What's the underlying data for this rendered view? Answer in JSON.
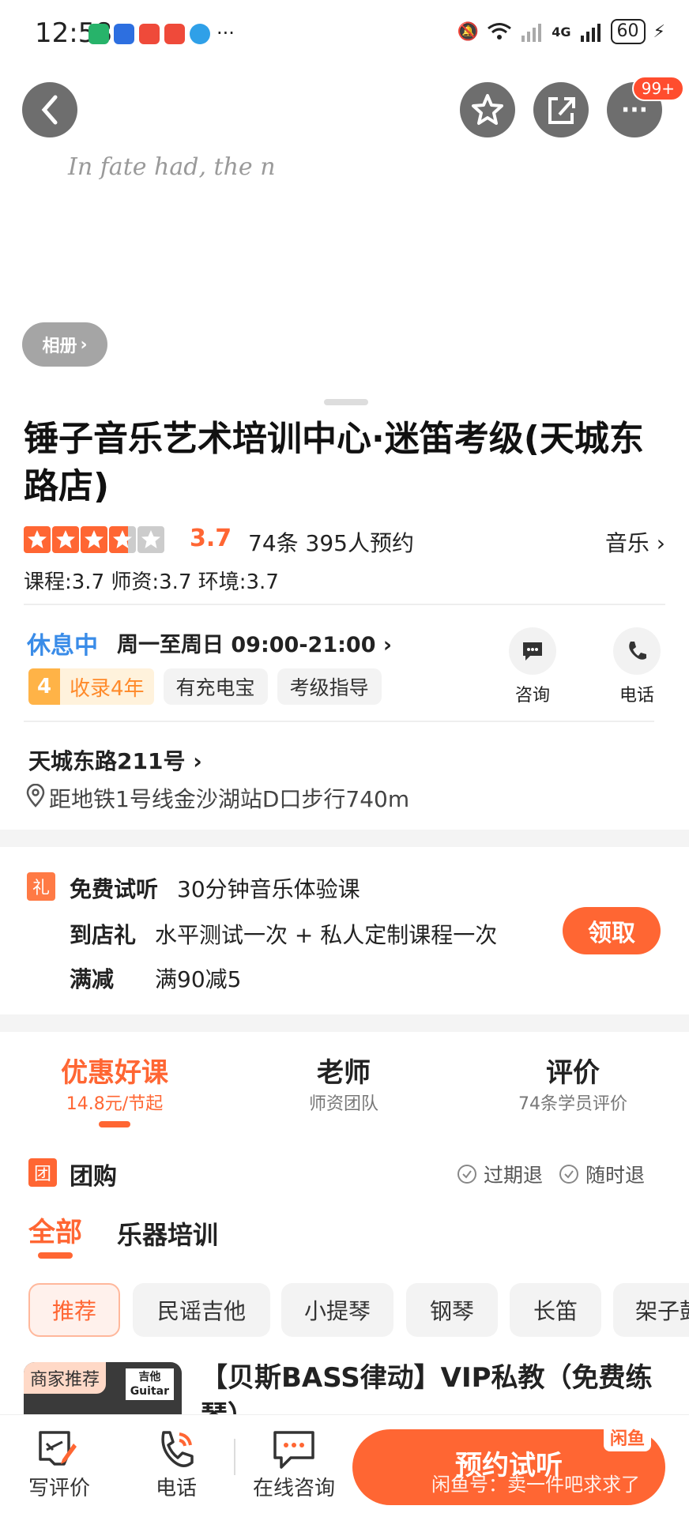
{
  "status": {
    "time": "12:58",
    "network": "4G",
    "battery": "60"
  },
  "topbar": {
    "badge": "99+"
  },
  "watermark": "In fate had, the n",
  "album_label": "相册",
  "shop": {
    "title": "锤子音乐艺术培训中心·迷笛考级(天城东路店)",
    "rating": "3.7",
    "rating_value": 3.7,
    "review_count": "74条",
    "bookings": "395人预约",
    "category": "音乐",
    "sub_scores": "课程:3.7  师资:3.7  环境:3.7"
  },
  "hours": {
    "status": "休息中",
    "text": "周一至周日 09:00-21:00"
  },
  "tags": {
    "years_num": "4",
    "years_text": "收录4年",
    "tag1": "有充电宝",
    "tag2": "考级指导"
  },
  "actions": {
    "consult": "咨询",
    "phone": "电话"
  },
  "address": {
    "street": "天城东路211号",
    "metro": "距地铁1号线金沙湖站D口步行740m"
  },
  "offers": {
    "gift_icon": "礼",
    "rows": [
      {
        "k": "免费试听",
        "v": "30分钟音乐体验课"
      },
      {
        "k": "到店礼",
        "v": "水平测试一次 + 私人定制课程一次"
      },
      {
        "k": "满减",
        "v": "满90减5"
      }
    ],
    "claim": "领取"
  },
  "tabs": [
    {
      "title": "优惠好课",
      "sub": "14.8元/节起"
    },
    {
      "title": "老师",
      "sub": "师资团队"
    },
    {
      "title": "评价",
      "sub": "74条学员评价"
    }
  ],
  "group": {
    "icon": "团",
    "title": "团购",
    "refund1": "过期退",
    "refund2": "随时退"
  },
  "subtabs": {
    "all": "全部",
    "training": "乐器培训"
  },
  "chips": [
    "推荐",
    "民谣吉他",
    "小提琴",
    "钢琴",
    "长笛",
    "架子鼓"
  ],
  "product": {
    "badge": "商家推荐",
    "thumb1": "吉他",
    "thumb2": "Guitar",
    "title": "【贝斯BASS律动】VIP私教（免费练琴）"
  },
  "bottom": {
    "review": "写评价",
    "phone": "电话",
    "online": "在线咨询",
    "book": "预约试听",
    "overlay": "闲鱼号：卖一件吧求求了",
    "logo": "闲鱼"
  },
  "colors": {
    "accent": "#ff6633",
    "blue": "#3a8ce8"
  }
}
